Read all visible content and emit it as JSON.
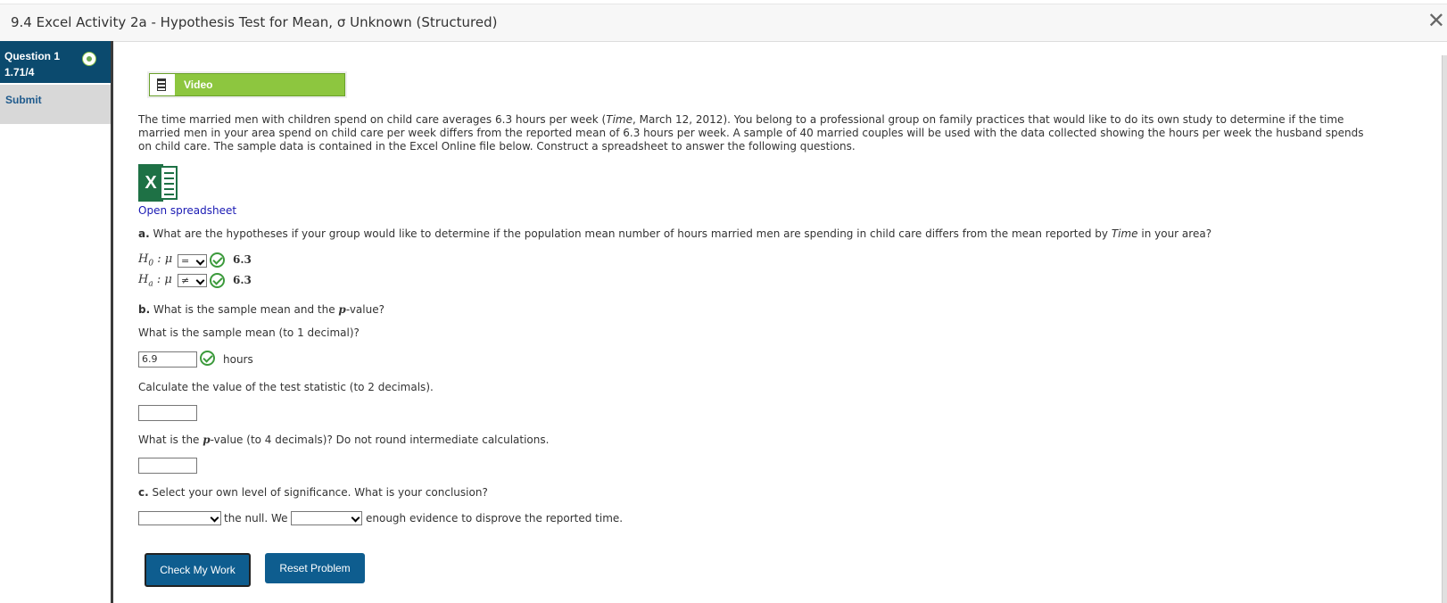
{
  "header": {
    "title": "9.4 Excel Activity 2a - Hypothesis Test for Mean, σ Unknown (Structured)",
    "close_glyph": "✕"
  },
  "sidebar": {
    "question_title": "Question 1",
    "question_score": "1.71/4",
    "submit_label": "Submit"
  },
  "video": {
    "label": "Video"
  },
  "problem": {
    "intro_before": "The time married men with children spend on child care averages 6.3 hours per week (",
    "intro_italic": "Time",
    "intro_after": ", March 12, 2012). You belong to a professional group on family practices that would like to do its own study to determine if the time married men in your area spend on child care per week differs from the reported mean of 6.3 hours per week. A sample of 40 married couples will be used with the data collected showing the hours per week the husband spends on child care. The sample data is contained in the Excel Online file below. Construct a spreadsheet to answer the following questions.",
    "excel_letter": "X",
    "open_spreadsheet": "Open spreadsheet"
  },
  "part_a": {
    "letter": "a.",
    "question_before": " What are the hypotheses if your group would like to determine if the population mean number of hours married men are spending in child care differs from the mean reported by ",
    "question_italic": "Time",
    "question_after": " in your area?",
    "h0_label": "H",
    "h0_sub": "0",
    "ha_label": "H",
    "ha_sub": "a",
    "mu_part": " : μ",
    "h0_operator": "=",
    "ha_operator": "≠",
    "h0_value": "6.3",
    "ha_value": "6.3"
  },
  "part_b": {
    "letter": "b.",
    "question_before": " What is the sample mean and the ",
    "question_p": "p",
    "question_after": "-value?",
    "mean_prompt": "What is the sample mean (to 1 decimal)?",
    "mean_value": "6.9",
    "mean_unit": "hours",
    "stat_prompt": "Calculate the value of the test statistic (to 2 decimals).",
    "stat_value": "",
    "pvalue_before": "What is the ",
    "pvalue_p": "p",
    "pvalue_after": "-value (to 4 decimals)? Do not round intermediate calculations.",
    "pvalue_value": ""
  },
  "part_c": {
    "letter": "c.",
    "question": " Select your own level of significance. What is your conclusion?",
    "select1_value": "",
    "text_mid": "the null. We",
    "select2_value": "",
    "text_end": "enough evidence to disprove the reported time."
  },
  "buttons": {
    "check": "Check My Work",
    "reset": "Reset Problem"
  },
  "colors": {
    "header_bg": "#0b4a6e",
    "video_green": "#8dc63f",
    "check_green": "#3c9a3c",
    "button_blue": "#0e5d8f",
    "excel_green": "#1e7145"
  }
}
